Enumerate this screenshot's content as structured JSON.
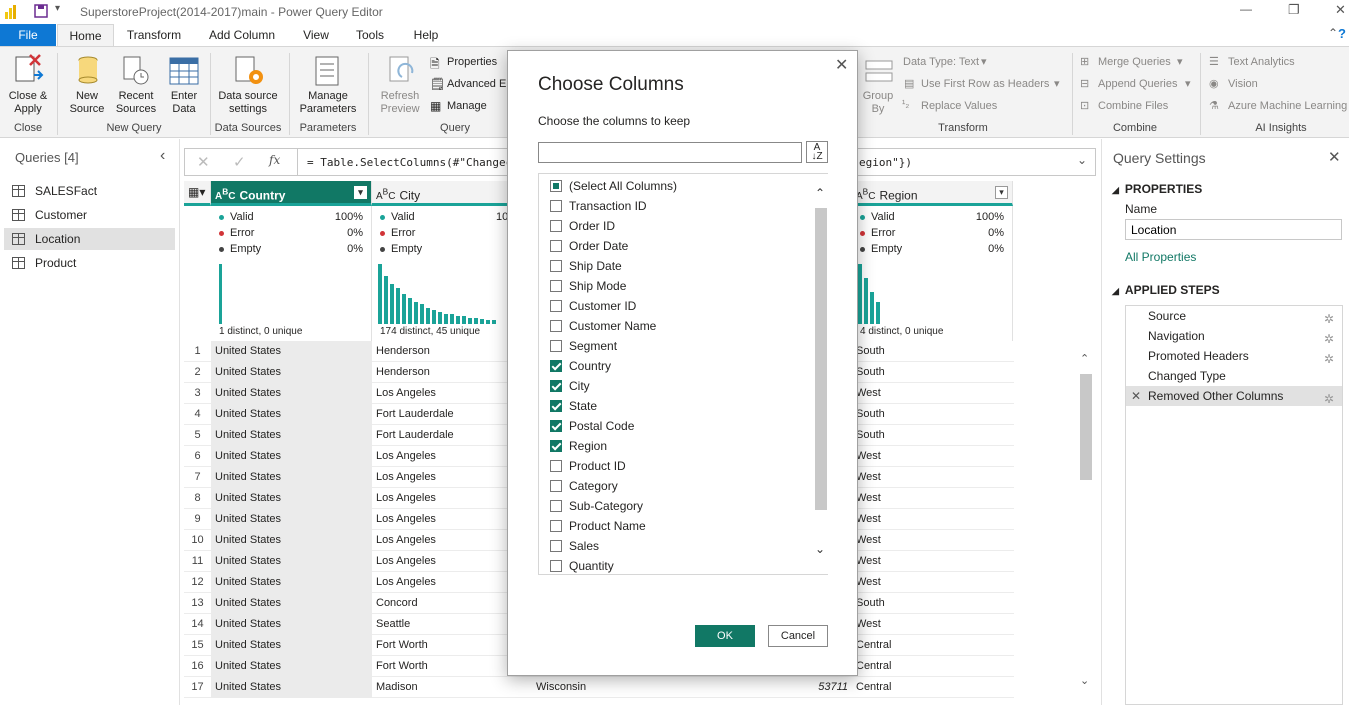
{
  "titlebar": {
    "title": "SuperstoreProject(2014-2017)main - Power Query Editor"
  },
  "tabs": [
    {
      "label": "File"
    },
    {
      "label": "Home"
    },
    {
      "label": "Transform"
    },
    {
      "label": "Add Column"
    },
    {
      "label": "View"
    },
    {
      "label": "Tools"
    },
    {
      "label": "Help"
    }
  ],
  "ribbon": {
    "close_apply": "Close &\nApply",
    "new_source": "New\nSource",
    "recent_sources": "Recent\nSources",
    "enter_data": "Enter\nData",
    "data_source_settings": "Data source\nsettings",
    "manage_parameters": "Manage\nParameters",
    "refresh_preview": "Refresh\nPreview",
    "properties": "Properties",
    "advanced_editor": "Advanced E",
    "manage": "Manage",
    "group_by": "Group\nBy",
    "data_type": "Data Type: Text",
    "use_first_row": "Use First Row as Headers",
    "replace_values": "Replace Values",
    "merge_queries": "Merge Queries",
    "append_queries": "Append Queries",
    "combine_files": "Combine Files",
    "text_analytics": "Text Analytics",
    "vision": "Vision",
    "azure_ml": "Azure Machine Learning",
    "groups": {
      "close": "Close",
      "new_query": "New Query",
      "data_sources": "Data Sources",
      "parameters": "Parameters",
      "query": "Query",
      "transform": "Transform",
      "combine": "Combine",
      "ai_insights": "AI Insights"
    }
  },
  "queries": {
    "title": "Queries [4]",
    "items": [
      "SALESFact",
      "Customer",
      "Location",
      "Product"
    ]
  },
  "formula": {
    "left": "= Table.SelectColumns(#\"Changec",
    "right": "egion\"})"
  },
  "columns": {
    "country": {
      "name": "Country",
      "valid_label": "Valid",
      "valid_pct": "100%",
      "error_label": "Error",
      "error_pct": "0%",
      "empty_label": "Empty",
      "empty_pct": "0%",
      "distinct": "1 distinct, 0 unique"
    },
    "city": {
      "name": "City",
      "valid_pct": "10",
      "distinct": "174 distinct, 45 unique"
    },
    "region": {
      "name": "Region",
      "valid_pct": "100%",
      "error_pct": "0%",
      "empty_pct": "0%",
      "distinct": "4 distinct, 0 unique"
    }
  },
  "rows": [
    {
      "n": "1",
      "country": "United States",
      "city": "Henderson",
      "region": "South"
    },
    {
      "n": "2",
      "country": "United States",
      "city": "Henderson",
      "region": "South"
    },
    {
      "n": "3",
      "country": "United States",
      "city": "Los Angeles",
      "region": "West"
    },
    {
      "n": "4",
      "country": "United States",
      "city": "Fort Lauderdale",
      "region": "South"
    },
    {
      "n": "5",
      "country": "United States",
      "city": "Fort Lauderdale",
      "region": "South"
    },
    {
      "n": "6",
      "country": "United States",
      "city": "Los Angeles",
      "region": "West"
    },
    {
      "n": "7",
      "country": "United States",
      "city": "Los Angeles",
      "region": "West"
    },
    {
      "n": "8",
      "country": "United States",
      "city": "Los Angeles",
      "region": "West"
    },
    {
      "n": "9",
      "country": "United States",
      "city": "Los Angeles",
      "region": "West"
    },
    {
      "n": "10",
      "country": "United States",
      "city": "Los Angeles",
      "region": "West"
    },
    {
      "n": "11",
      "country": "United States",
      "city": "Los Angeles",
      "region": "West"
    },
    {
      "n": "12",
      "country": "United States",
      "city": "Los Angeles",
      "region": "West"
    },
    {
      "n": "13",
      "country": "United States",
      "city": "Concord",
      "region": "South"
    },
    {
      "n": "14",
      "country": "United States",
      "city": "Seattle",
      "region": "West"
    },
    {
      "n": "15",
      "country": "United States",
      "city": "Fort Worth",
      "region": "Central"
    },
    {
      "n": "16",
      "country": "United States",
      "city": "Fort Worth",
      "region": "Central"
    },
    {
      "n": "17",
      "country": "United States",
      "city": "Madison",
      "state": "Wisconsin",
      "postal": "53711",
      "region": "Central"
    }
  ],
  "settings": {
    "title": "Query Settings",
    "properties": "PROPERTIES",
    "name_label": "Name",
    "name_value": "Location",
    "all_properties": "All Properties",
    "applied_steps": "APPLIED STEPS",
    "steps": [
      "Source",
      "Navigation",
      "Promoted Headers",
      "Changed Type",
      "Removed Other Columns"
    ]
  },
  "dialog": {
    "title": "Choose Columns",
    "subtitle": "Choose the columns to keep",
    "ok": "OK",
    "cancel": "Cancel",
    "items": [
      {
        "label": "(Select All Columns)",
        "state": "partial"
      },
      {
        "label": "Transaction ID",
        "state": "off"
      },
      {
        "label": "Order ID",
        "state": "off"
      },
      {
        "label": "Order Date",
        "state": "off"
      },
      {
        "label": "Ship Date",
        "state": "off"
      },
      {
        "label": "Ship Mode",
        "state": "off"
      },
      {
        "label": "Customer ID",
        "state": "off"
      },
      {
        "label": "Customer Name",
        "state": "off"
      },
      {
        "label": "Segment",
        "state": "off"
      },
      {
        "label": "Country",
        "state": "on"
      },
      {
        "label": "City",
        "state": "on"
      },
      {
        "label": "State",
        "state": "on"
      },
      {
        "label": "Postal Code",
        "state": "on"
      },
      {
        "label": "Region",
        "state": "on"
      },
      {
        "label": "Product ID",
        "state": "off"
      },
      {
        "label": "Category",
        "state": "off"
      },
      {
        "label": "Sub-Category",
        "state": "off"
      },
      {
        "label": "Product Name",
        "state": "off"
      },
      {
        "label": "Sales",
        "state": "off"
      },
      {
        "label": "Quantity",
        "state": "off"
      }
    ]
  },
  "colors": {
    "accent": "#117865",
    "file_tab": "#0e78d4",
    "teal": "#1aa398"
  }
}
